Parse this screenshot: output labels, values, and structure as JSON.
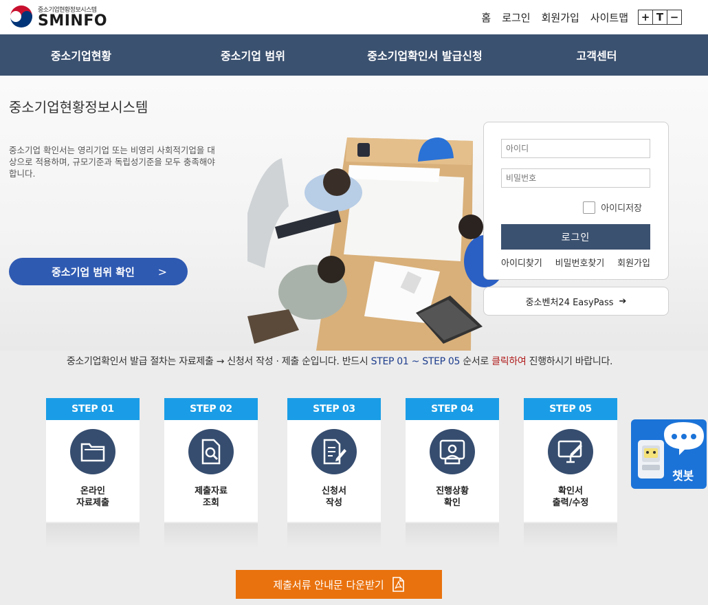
{
  "header": {
    "logo_sub": "중소기업현황정보시스템",
    "logo_main": "SMINFO",
    "util_links": [
      "홈",
      "로그인",
      "회원가입",
      "사이트맵"
    ],
    "font_controls": [
      "+",
      "T",
      "−"
    ]
  },
  "nav": {
    "items": [
      "중소기업현황",
      "중소기업 범위",
      "중소기업확인서 발급신청",
      "고객센터"
    ]
  },
  "hero": {
    "title": "중소기업현황정보시스템",
    "description": "중소기업 확인서는 영리기업 또는 비영리 사회적기업을 대상으로 적용하며, 규모기준과 독립성기준을 모두 충족해야 합니다.",
    "range_button": "중소기업 범위 확인",
    "range_arrow": ">"
  },
  "login": {
    "id_placeholder": "아이디",
    "pw_placeholder": "비밀번호",
    "save_id": "아이디저장",
    "login_button": "로그인",
    "links": [
      "아이디찾기",
      "비밀번호찾기",
      "회원가입"
    ],
    "easypass": "중소벤처24 EasyPass"
  },
  "notice": {
    "part1": "중소기업확인서 발급 절차는 자료제출 → 신청서 작성 · 제출 순입니다. 반드시 ",
    "part2": "STEP 01 ~ STEP 05",
    "part3": " 순서로 ",
    "part4": "클릭하여",
    "part5": " 진행하시기 바랍니다."
  },
  "steps": [
    {
      "head": "STEP 01",
      "label": "온라인\n자료제출",
      "icon": "folder-icon"
    },
    {
      "head": "STEP 02",
      "label": "제출자료\n조회",
      "icon": "document-search-icon"
    },
    {
      "head": "STEP 03",
      "label": "신청서\n작성",
      "icon": "document-edit-icon"
    },
    {
      "head": "STEP 04",
      "label": "진행상황\n확인",
      "icon": "user-status-icon"
    },
    {
      "head": "STEP 05",
      "label": "확인서\n출력/수정",
      "icon": "monitor-edit-icon"
    }
  ],
  "chatbot": {
    "label": "챗봇"
  },
  "download": {
    "label": "제출서류 안내문 다운받기"
  },
  "colors": {
    "nav": "#3b5170",
    "step_head": "#1a9de6",
    "step_circle": "#364d6f",
    "download": "#e9720e",
    "chatbot": "#1b73d8"
  }
}
